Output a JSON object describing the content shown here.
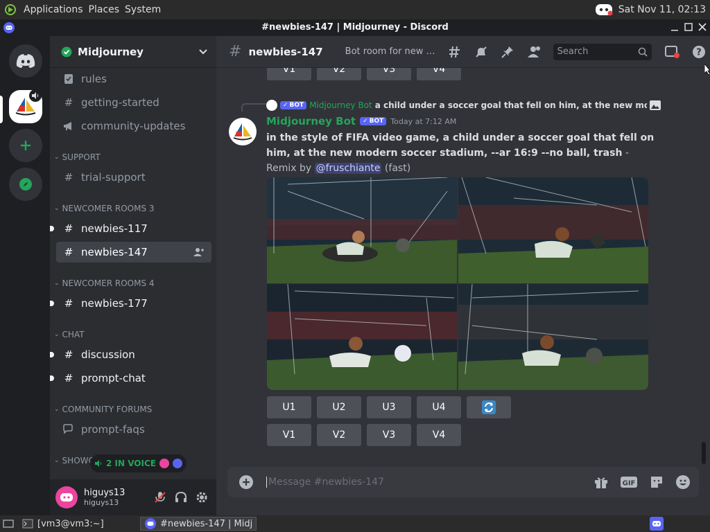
{
  "os_bar": {
    "menus": [
      "Applications",
      "Places",
      "System"
    ],
    "clock": "Sat Nov 11, 02:13"
  },
  "window": {
    "title": "#newbies-147 | Midjourney - Discord"
  },
  "server": {
    "name": "Midjourney"
  },
  "sidebar": {
    "channels_top": [
      {
        "label": "rules"
      },
      {
        "label": "getting-started"
      },
      {
        "label": "community-updates"
      }
    ],
    "categories": {
      "support": "SUPPORT",
      "newcomer3": "NEWCOMER ROOMS 3",
      "newcomer4": "NEWCOMER ROOMS 4",
      "chat": "CHAT",
      "forums": "COMMUNITY FORUMS",
      "showcase": "SHOWC"
    },
    "channels": {
      "trial_support": "trial-support",
      "newbies_117": "newbies-117",
      "newbies_147": "newbies-147",
      "newbies_177": "newbies-177",
      "discussion": "discussion",
      "prompt_chat": "prompt-chat",
      "prompt_faqs": "prompt-faqs"
    },
    "voice": "2 IN VOICE"
  },
  "user": {
    "display_name": "higuys13",
    "username": "higuys13"
  },
  "chat_header": {
    "channel": "newbies-147",
    "topic": "Bot room for new users",
    "search_placeholder": "Search"
  },
  "messages": {
    "prev_buttons": [
      "V1",
      "V2",
      "V3",
      "V4"
    ],
    "reply": {
      "bot_label": "BOT",
      "author": "Midjourney Bot",
      "text": "a child under a soccer goal that fell on him, at the new modern soccer stadium"
    },
    "message": {
      "author": "Midjourney Bot",
      "bot_label": "BOT",
      "timestamp": "Today at 7:12 AM",
      "prompt": "in the style of FIFA video game, a child under a soccer goal that fell on him, at the new modern soccer stadium, --ar 16:9 --no ball, trash",
      "suffix": " - Remix by ",
      "mention": "@fruschiante",
      "speed": " (fast)"
    },
    "upscale_buttons": [
      "U1",
      "U2",
      "U3",
      "U4"
    ],
    "variation_buttons": [
      "V1",
      "V2",
      "V3",
      "V4"
    ]
  },
  "composer": {
    "placeholder": "Message #newbies-147"
  },
  "taskbar": {
    "terminal": "[vm3@vm3:~]",
    "discord": "#newbies-147 | Midj..."
  },
  "colors": {
    "blurple": "#5865f2",
    "green": "#23a55a",
    "bg": "#313338",
    "sidebar": "#2b2d31",
    "rail": "#1e1f22"
  }
}
